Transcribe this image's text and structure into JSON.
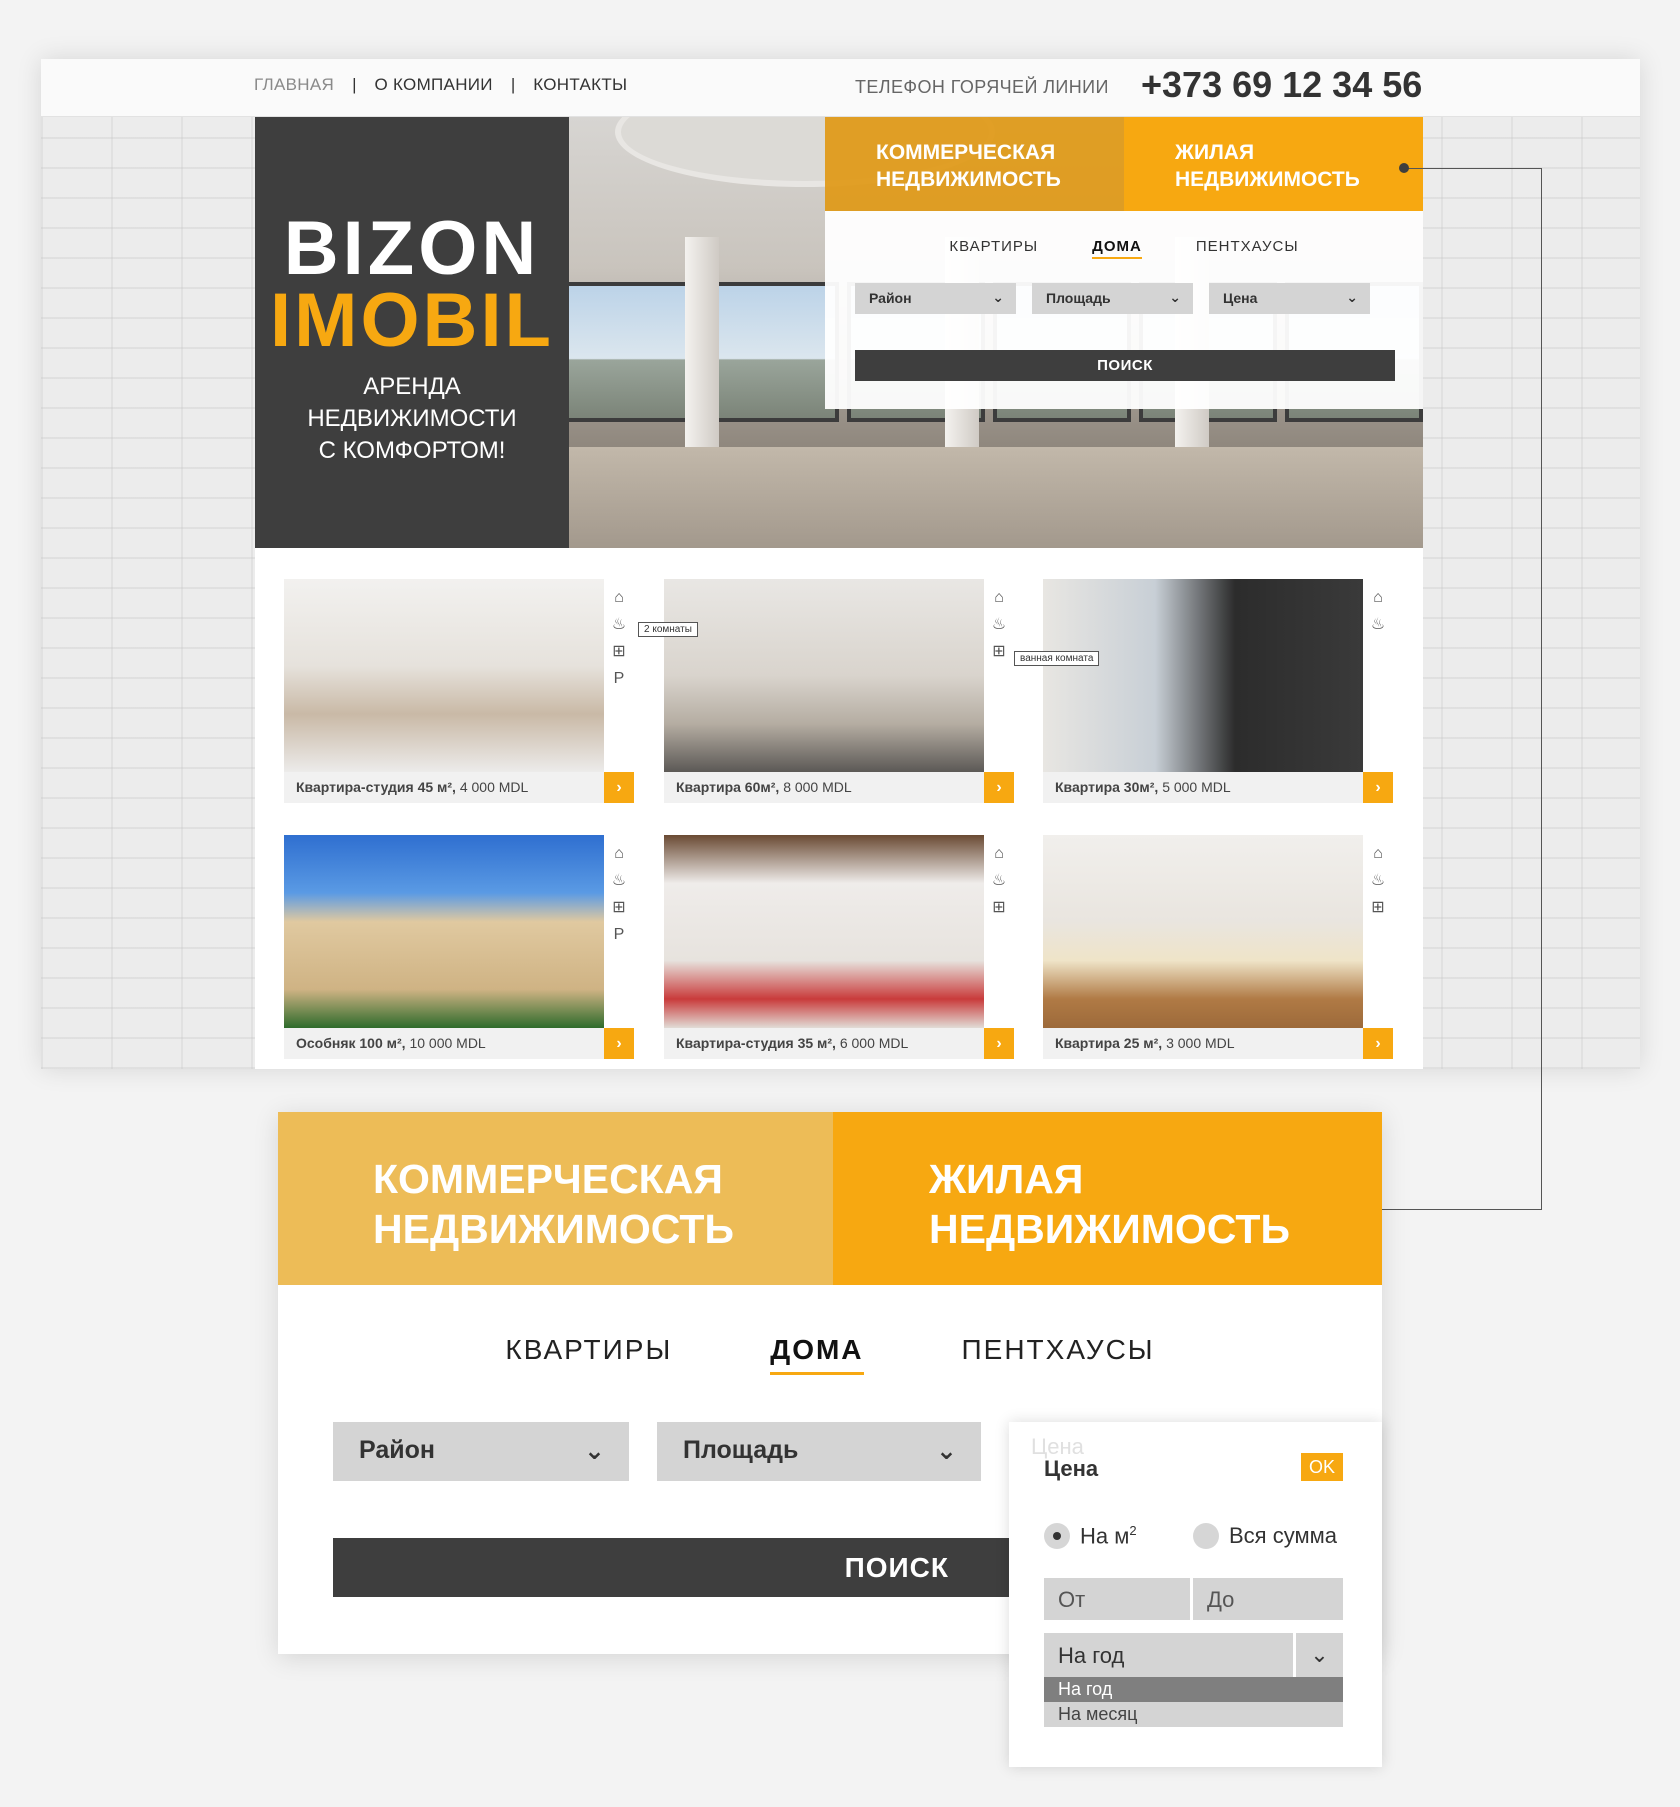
{
  "nav": {
    "home": "ГЛАВНАЯ",
    "sep": "|",
    "about": "О КОМПАНИИ",
    "contacts": "КОНТАКТЫ"
  },
  "hotline": {
    "label": "ТЕЛЕФОН ГОРЯЧЕЙ ЛИНИИ",
    "number": "+373 69 12 34 56"
  },
  "brand": {
    "line1": "BIZON",
    "line2": "IMOBIL",
    "slogan1": "АРЕНДА",
    "slogan2": "НЕДВИЖИМОСТИ",
    "slogan3": "С КОМФОРТОМ!"
  },
  "property_tabs": {
    "commercial1": "КОММЕРЧЕСКАЯ",
    "commercial2": "НЕДВИЖИМОСТЬ",
    "residential1": "ЖИЛАЯ",
    "residential2": "НЕДВИЖИМОСТЬ"
  },
  "categories": [
    "КВАРТИРЫ",
    "ДОМА",
    "ПЕНТХАУСЫ"
  ],
  "filters": {
    "district": "Район",
    "area": "Площадь",
    "price": "Цена",
    "search": "ПОИСК"
  },
  "listings": [
    {
      "title": "Квартира-студия 45 м²,",
      "price": "4 000 MDL",
      "icons": [
        "⌂",
        "♨",
        "⊞",
        "P"
      ]
    },
    {
      "title": "Квартира 60м²,",
      "price": "8 000 MDL",
      "icons": [
        "⌂",
        "♨",
        "⊞"
      ]
    },
    {
      "title": "Квартира 30м²,",
      "price": "5 000 MDL",
      "icons": [
        "⌂",
        "♨"
      ]
    },
    {
      "title": "Особняк 100 м²,",
      "price": "10 000 MDL",
      "icons": [
        "⌂",
        "♨",
        "⊞",
        "P"
      ]
    },
    {
      "title": "Квартира-студия 35 м²,",
      "price": "6 000 MDL",
      "icons": [
        "⌂",
        "♨",
        "⊞"
      ]
    },
    {
      "title": "Квартира 25 м²,",
      "price": "3 000 MDL",
      "icons": [
        "⌂",
        "♨",
        "⊞"
      ]
    }
  ],
  "tooltips": {
    "rooms": "2 комнаты",
    "bath": "ванная комната"
  },
  "price_popup": {
    "ghost": "Цена",
    "title": "Цена",
    "ok": "OK",
    "per_m2": "На м",
    "per_m2_sup": "2",
    "total": "Вся сумма",
    "from": "От",
    "to": "До",
    "period": "На год",
    "options": [
      "На год",
      "На месяц"
    ]
  },
  "colors": {
    "accent": "#f7a811",
    "dark": "#3e3e3e",
    "commercial": "#edbc57"
  }
}
